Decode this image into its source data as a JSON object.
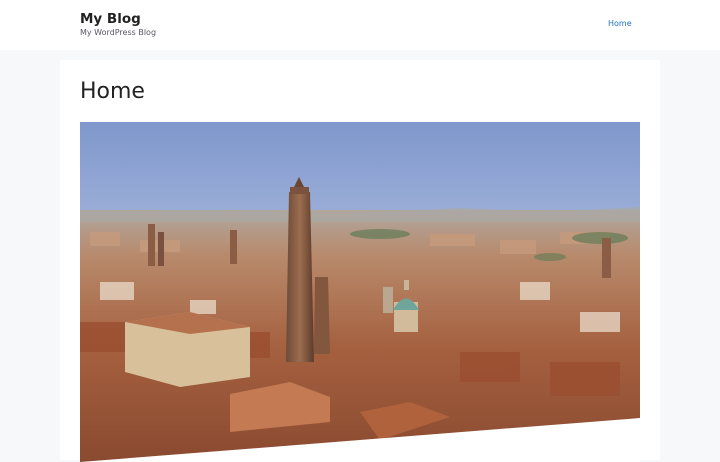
{
  "header": {
    "site_title": "My Blog",
    "tagline": "My WordPress Blog",
    "nav": [
      {
        "label": "Home"
      }
    ]
  },
  "page": {
    "title": "Home",
    "featured_image": {
      "subject": "aerial-city-towers"
    }
  },
  "colors": {
    "link": "#1e73be",
    "background": "#f7f8f9",
    "card": "#ffffff",
    "text": "#222222"
  }
}
